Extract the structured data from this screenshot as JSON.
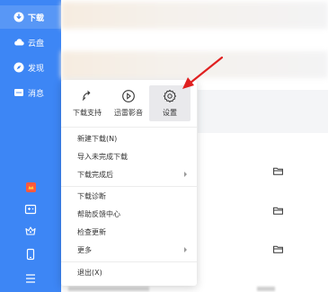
{
  "sidebar": {
    "items": [
      {
        "label": "下载",
        "icon": "download-icon"
      },
      {
        "label": "云盘",
        "icon": "cloud-icon"
      },
      {
        "label": "发现",
        "icon": "compass-icon"
      },
      {
        "label": "消息",
        "icon": "message-icon"
      }
    ],
    "bottom_icons": [
      "gift-icon",
      "game-icon",
      "vip-crown-icon",
      "phone-icon",
      "menu-icon"
    ]
  },
  "toolbar": {
    "items": [
      {
        "label": "下载支持",
        "icon": "link-icon"
      },
      {
        "label": "迅雷影音",
        "icon": "player-icon"
      },
      {
        "label": "设置",
        "icon": "gear-icon",
        "selected": true
      }
    ]
  },
  "menu": {
    "items": [
      {
        "label": "新建下载(N)",
        "submenu": false
      },
      {
        "label": "导入未完成下载",
        "submenu": false
      },
      {
        "label": "下载完成后",
        "submenu": true
      },
      {
        "label": "下载诊断",
        "submenu": false
      },
      {
        "label": "帮助反馈中心",
        "submenu": false
      },
      {
        "label": "检查更新",
        "submenu": false
      },
      {
        "label": "更多",
        "submenu": true
      },
      {
        "label": "退出(X)",
        "submenu": false
      }
    ]
  },
  "colors": {
    "sidebar_bg": "#3d86f5",
    "annotation_arrow": "#e02020"
  }
}
